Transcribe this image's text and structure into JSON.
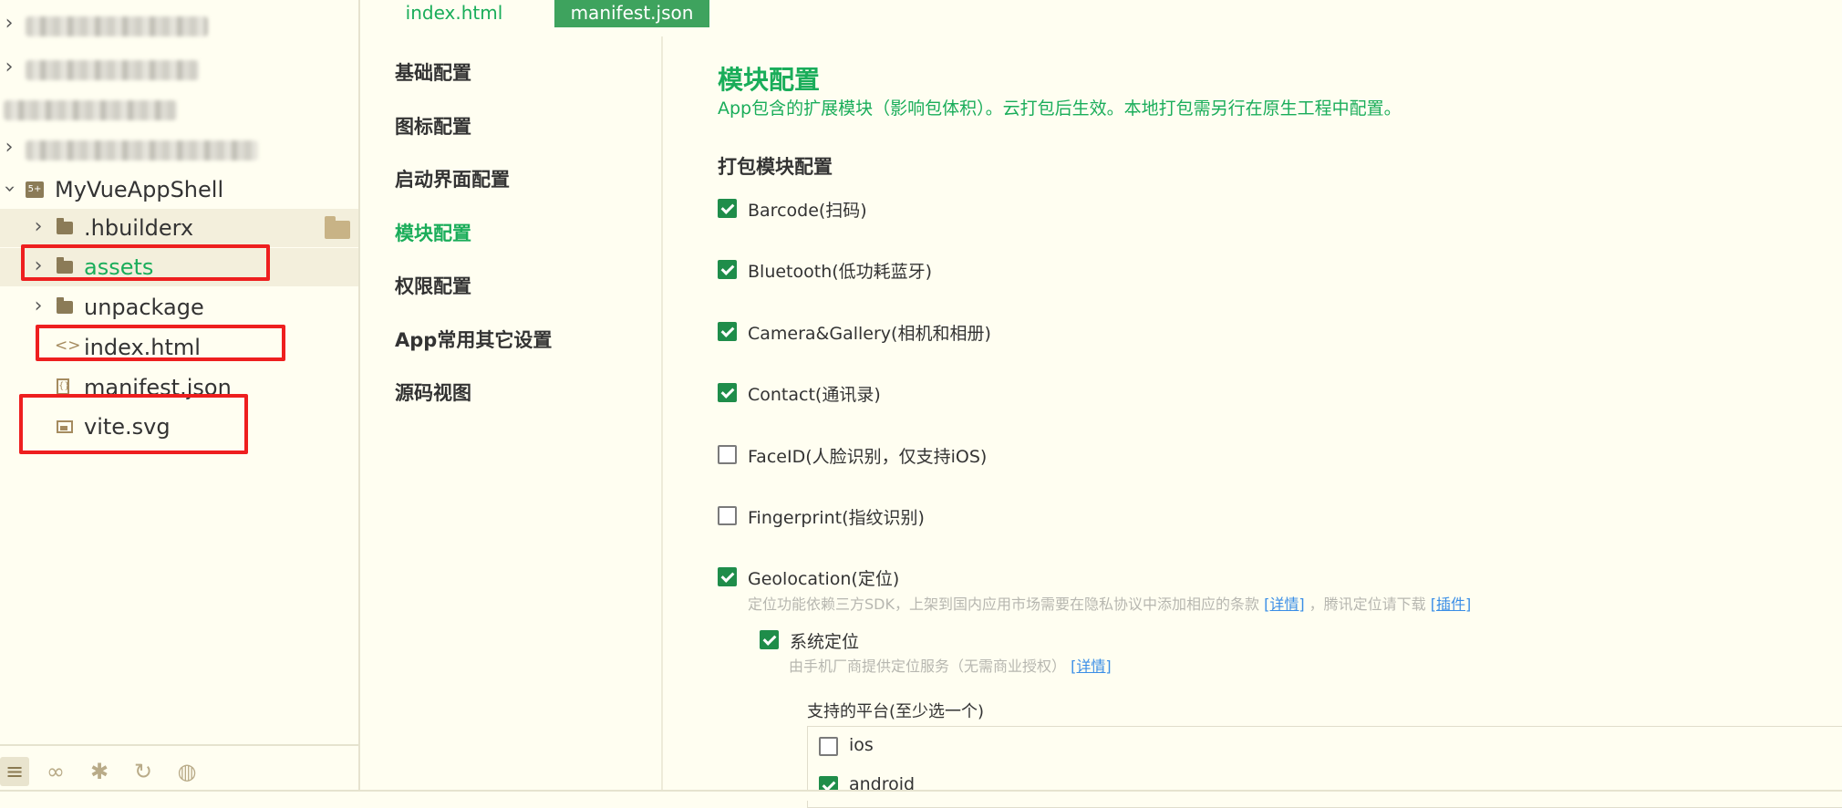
{
  "tabs": [
    {
      "label": "index.html"
    },
    {
      "label": "manifest.json"
    }
  ],
  "file_tree": {
    "project_name": "MyVueAppShell",
    "project_icon_text": "5+",
    "items": [
      {
        "label": ".hbuilderx"
      },
      {
        "label": "assets"
      },
      {
        "label": "unpackage"
      },
      {
        "label": "index.html"
      },
      {
        "label": "manifest.json"
      },
      {
        "label": "vite.svg"
      }
    ]
  },
  "settings_nav": {
    "items": [
      {
        "label": "基础配置"
      },
      {
        "label": "图标配置"
      },
      {
        "label": "启动界面配置"
      },
      {
        "label": "模块配置"
      },
      {
        "label": "权限配置"
      },
      {
        "label": "App常用其它设置"
      },
      {
        "label": "源码视图"
      }
    ],
    "active_index": 3
  },
  "modules": {
    "title": "模块配置",
    "description": "App包含的扩展模块（影响包体积）。云打包后生效。本地打包需另行在原生工程中配置。",
    "section_title": "打包模块配置",
    "items": [
      {
        "label": "Barcode(扫码)",
        "checked": true
      },
      {
        "label": "Bluetooth(低功耗蓝牙)",
        "checked": true
      },
      {
        "label": "Camera&Gallery(相机和相册)",
        "checked": true
      },
      {
        "label": "Contact(通讯录)",
        "checked": true
      },
      {
        "label": "FaceID(人脸识别，仅支持iOS)",
        "checked": false
      },
      {
        "label": "Fingerprint(指纹识别)",
        "checked": false
      },
      {
        "label": "Geolocation(定位)",
        "checked": true
      }
    ],
    "geolocation_hint": {
      "text1": "定位功能依赖三方SDK，上架到国内应用市场需要在隐私协议中添加相应的条款",
      "link1": "[详情]",
      "text2": "，腾讯定位请下载",
      "link2": "[插件]"
    },
    "system_location": {
      "label": "系统定位",
      "checked": true,
      "hint": "由手机厂商提供定位服务（无需商业授权）",
      "hint_link": "[详情]"
    },
    "platforms": {
      "label": "支持的平台(至少选一个)",
      "items": [
        {
          "label": "ios",
          "checked": false
        },
        {
          "label": "android",
          "checked": true
        }
      ]
    }
  },
  "colors": {
    "accent": "#1aad5a",
    "active_tab": "#3ea35e",
    "annotation_red": "#ee1f1f",
    "background": "#fffef1"
  }
}
